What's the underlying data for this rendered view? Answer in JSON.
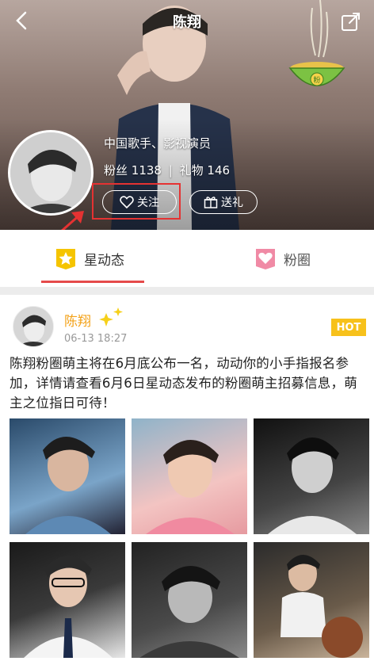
{
  "header": {
    "title": "陈翔",
    "description": "中国歌手、影视演员",
    "fans_label": "粉丝",
    "fans_count": "1138",
    "gift_label": "礼物",
    "gift_count": "146",
    "follow_label": "关注",
    "send_gift_label": "送礼",
    "bowl_badge": "粉"
  },
  "tabs": [
    {
      "label": "星动态",
      "active": true,
      "icon": "star-icon"
    },
    {
      "label": "粉圈",
      "active": false,
      "icon": "heart-chat-icon"
    }
  ],
  "post": {
    "author": "陈翔",
    "time": "06-13 18:27",
    "badge": "HOT",
    "content": "陈翔粉圈萌主将在6月底公布一名，动动你的小手指报名参加，详情请查看6月6日星动态发布的粉圈萌主招募信息，萌主之位指日可待！",
    "photo_count": 6
  },
  "colors": {
    "accent_red": "#e54a4a",
    "author_orange": "#f3a21a",
    "hot_yellow": "#f7c11b",
    "tab_icon_yellow": "#f5c400",
    "tab_icon_pink": "#f08aa5"
  }
}
